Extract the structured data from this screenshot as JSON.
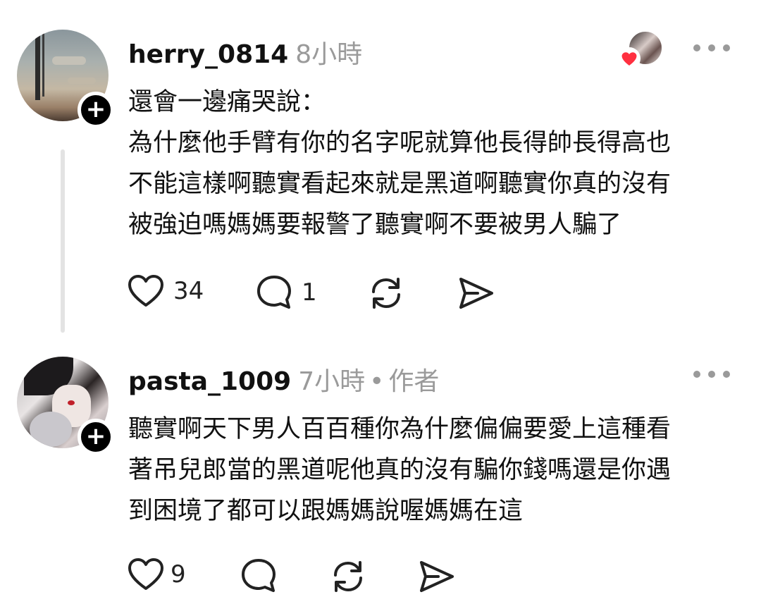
{
  "comments": [
    {
      "username": "herry_0814",
      "time": "8小時",
      "badge": "",
      "lines": [
        "還會一邊痛哭說：",
        "為什麼他手臂有你的名字呢就算他長得帥長得高也",
        "不能這樣啊聽實看起來就是黑道啊聽實你真的沒有",
        "被強迫嗎媽媽要報警了聽實啊不要被男人騙了"
      ],
      "likes": "34",
      "replies": "1"
    },
    {
      "username": "pasta_1009",
      "time": "7小時",
      "separator": "•",
      "badge": "作者",
      "lines": [
        "聽實啊天下男人百百種你為什麼偏偏要愛上這種看",
        "著吊兒郎當的黑道呢他真的沒有騙你錢嗎還是你遇",
        "到困境了都可以跟媽媽說喔媽媽在這"
      ],
      "likes": "9",
      "replies": ""
    }
  ],
  "icons": {
    "follow": "plus-icon",
    "like": "heart-icon",
    "reply": "comment-icon",
    "repost": "repost-icon",
    "share": "send-icon",
    "more": "more-icon"
  },
  "colors": {
    "text": "#111111",
    "meta": "#9a9a9a",
    "heart_badge": "#ff3040"
  },
  "follow_symbol": "+"
}
